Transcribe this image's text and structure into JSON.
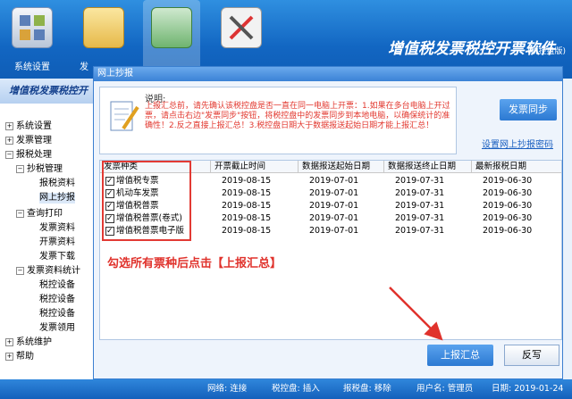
{
  "toolbar": {
    "items": [
      {
        "label": "系统设置"
      },
      {
        "label": "发"
      }
    ]
  },
  "app": {
    "title": "增值税发票税控开票软件",
    "subtitle": "(税控盘版)"
  },
  "tree": {
    "header": "增值税发票税控开",
    "items": [
      {
        "label": "系统设置",
        "mark": "+"
      },
      {
        "label": "发票管理",
        "mark": "+"
      },
      {
        "label": "报税处理",
        "mark": "−"
      },
      {
        "label": "抄税管理",
        "mark": "−"
      },
      {
        "label": "报税资料"
      },
      {
        "label": "网上抄报"
      },
      {
        "label": "查询打印",
        "mark": "−"
      },
      {
        "label": "发票资料"
      },
      {
        "label": "开票资料"
      },
      {
        "label": "发票下载"
      },
      {
        "label": "发票资料统计",
        "mark": "−"
      },
      {
        "label": "税控设备"
      },
      {
        "label": "税控设备"
      },
      {
        "label": "税控设备"
      },
      {
        "label": "发票领用"
      },
      {
        "label": "系统维护",
        "mark": "+"
      },
      {
        "label": "帮助",
        "mark": "+"
      }
    ]
  },
  "dialog": {
    "title": "网上抄报",
    "note_label": "说明:",
    "note_text": "上报汇总前，请先确认该税控盘是否一直在同一电脑上开票：1.如果在多台电脑上开过票，请点击右边\"发票同步\"按钮，将税控盘中的发票同步到本地电脑，以确保统计的准确性！2.反之直接上报汇总！3.税控盘日期大于数据报送起始日期才能上报汇总！",
    "sync_button": "发票同步",
    "pwd_link": "设置网上抄报密码",
    "table": {
      "headers": [
        "发票种类",
        "开票截止时间",
        "数据报送起始日期",
        "数据报送终止日期",
        "最新报税日期"
      ],
      "rows": [
        [
          "增值税专票",
          "2019-08-15",
          "2019-07-01",
          "2019-07-31",
          "2019-06-30"
        ],
        [
          "机动车发票",
          "2019-08-15",
          "2019-07-01",
          "2019-07-31",
          "2019-06-30"
        ],
        [
          "增值税普票",
          "2019-08-15",
          "2019-07-01",
          "2019-07-31",
          "2019-06-30"
        ],
        [
          "增值税普票(卷式)",
          "2019-08-15",
          "2019-07-01",
          "2019-07-31",
          "2019-06-30"
        ],
        [
          "增值税普票电子版",
          "2019-08-15",
          "2019-07-01",
          "2019-07-31",
          "2019-06-30"
        ]
      ]
    },
    "annotation": "勾选所有票种后点击【上报汇总】",
    "summary_button": "上报汇总",
    "reverse_button": "反写"
  },
  "status": {
    "network": "网络: 连接",
    "disk": "税控盘: 插入",
    "report_disk": "报税盘: 移除",
    "user": "用户名: 管理员",
    "date": "日期: 2019-01-24"
  },
  "colors": {
    "accent": "#1a6fd0",
    "annotation": "#e0322c"
  }
}
